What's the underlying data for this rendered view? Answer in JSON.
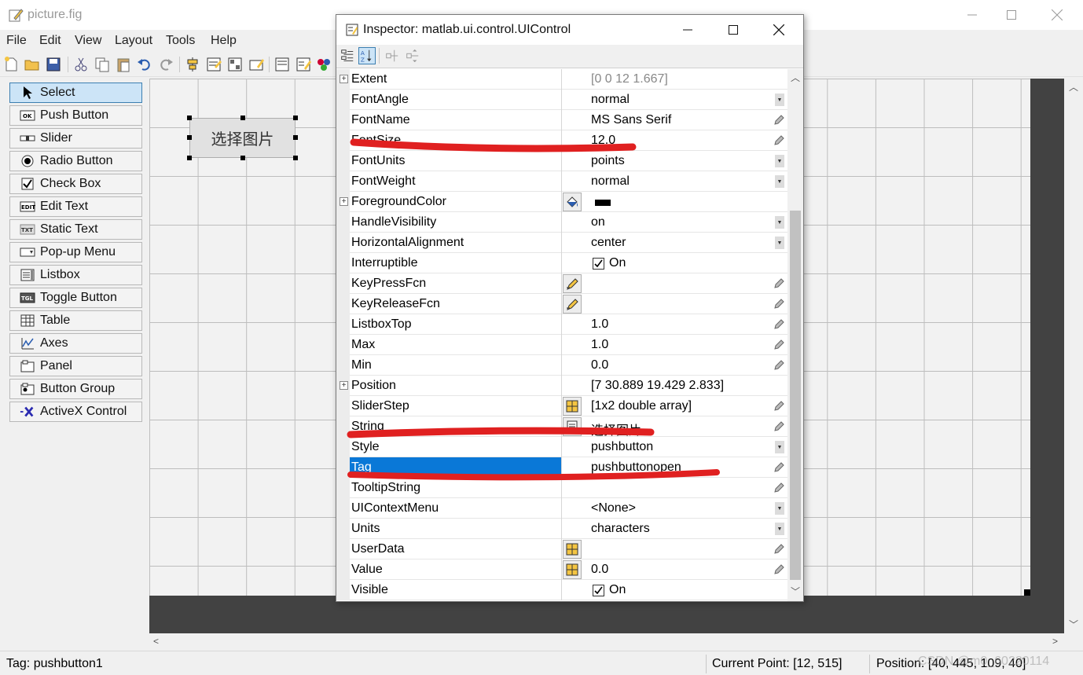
{
  "window": {
    "title": "picture.fig",
    "icon": "figure-edit-icon"
  },
  "menu": [
    "File",
    "Edit",
    "View",
    "Layout",
    "Tools",
    "Help"
  ],
  "palette": [
    {
      "label": "Select",
      "icon": "cursor-arrow-icon",
      "selected": true
    },
    {
      "label": "Push Button",
      "icon": "push-button-icon"
    },
    {
      "label": "Slider",
      "icon": "slider-icon"
    },
    {
      "label": "Radio Button",
      "icon": "radio-button-icon"
    },
    {
      "label": "Check Box",
      "icon": "check-box-icon"
    },
    {
      "label": "Edit Text",
      "icon": "edit-text-icon"
    },
    {
      "label": "Static Text",
      "icon": "static-text-icon"
    },
    {
      "label": "Pop-up Menu",
      "icon": "popup-menu-icon"
    },
    {
      "label": "Listbox",
      "icon": "listbox-icon"
    },
    {
      "label": "Toggle Button",
      "icon": "toggle-button-icon"
    },
    {
      "label": "Table",
      "icon": "table-icon"
    },
    {
      "label": "Axes",
      "icon": "axes-icon"
    },
    {
      "label": "Panel",
      "icon": "panel-icon"
    },
    {
      "label": "Button Group",
      "icon": "button-group-icon"
    },
    {
      "label": "ActiveX Control",
      "icon": "activex-icon"
    }
  ],
  "canvas": {
    "pushbutton_label": "选择图片"
  },
  "status": {
    "tag": "Tag: pushbutton1",
    "current_point": "Current Point:  [12, 515]",
    "position": "Position: [40, 445, 109, 40]",
    "watermark": "CSDN @m0_60220114"
  },
  "inspector": {
    "title": "Inspector:  matlab.ui.control.UIControl",
    "rows": [
      {
        "name": "Extent",
        "value": "[0 0 12 1.667]",
        "expand": true,
        "dim": true
      },
      {
        "name": "FontAngle",
        "value": "normal",
        "ctrl": "drop"
      },
      {
        "name": "FontName",
        "value": "MS Sans Serif",
        "ctrl": "edit"
      },
      {
        "name": "FontSize",
        "value": "12.0",
        "ctrl": "edit"
      },
      {
        "name": "FontUnits",
        "value": "points",
        "ctrl": "drop"
      },
      {
        "name": "FontWeight",
        "value": "normal",
        "ctrl": "drop"
      },
      {
        "name": "ForegroundColor",
        "value": "",
        "expand": true,
        "icon": "paint-bucket-icon",
        "swatch": "#000000"
      },
      {
        "name": "HandleVisibility",
        "value": "on",
        "ctrl": "drop"
      },
      {
        "name": "HorizontalAlignment",
        "value": "center",
        "ctrl": "drop"
      },
      {
        "name": "Interruptible",
        "value": "On",
        "check": true
      },
      {
        "name": "KeyPressFcn",
        "value": "",
        "icon": "callback-pencil-icon",
        "ctrl": "edit"
      },
      {
        "name": "KeyReleaseFcn",
        "value": "",
        "icon": "callback-pencil-icon",
        "ctrl": "edit"
      },
      {
        "name": "ListboxTop",
        "value": "1.0",
        "ctrl": "edit"
      },
      {
        "name": "Max",
        "value": "1.0",
        "ctrl": "edit"
      },
      {
        "name": "Min",
        "value": "0.0",
        "ctrl": "edit"
      },
      {
        "name": "Position",
        "value": "[7 30.889 19.429 2.833]",
        "expand": true
      },
      {
        "name": "SliderStep",
        "value": "[1x2  double array]",
        "icon": "array-grid-icon",
        "ctrl": "edit"
      },
      {
        "name": "String",
        "value": "选择图片",
        "icon": "text-doc-icon",
        "ctrl": "edit"
      },
      {
        "name": "Style",
        "value": "pushbutton",
        "ctrl": "drop"
      },
      {
        "name": "Tag",
        "value": "pushbuttonopen",
        "ctrl": "edit",
        "selected": true
      },
      {
        "name": "TooltipString",
        "value": "",
        "ctrl": "edit"
      },
      {
        "name": "UIContextMenu",
        "value": "<None>",
        "ctrl": "drop"
      },
      {
        "name": "Units",
        "value": "characters",
        "ctrl": "drop"
      },
      {
        "name": "UserData",
        "value": "",
        "icon": "array-grid-icon",
        "ctrl": "edit"
      },
      {
        "name": "Value",
        "value": "0.0",
        "icon": "array-grid-icon",
        "ctrl": "edit"
      },
      {
        "name": "Visible",
        "value": "On",
        "check": true
      }
    ]
  },
  "colors": {
    "selection": "#0a78d7",
    "annotation": "#e02020",
    "dark_area": "#424242"
  }
}
